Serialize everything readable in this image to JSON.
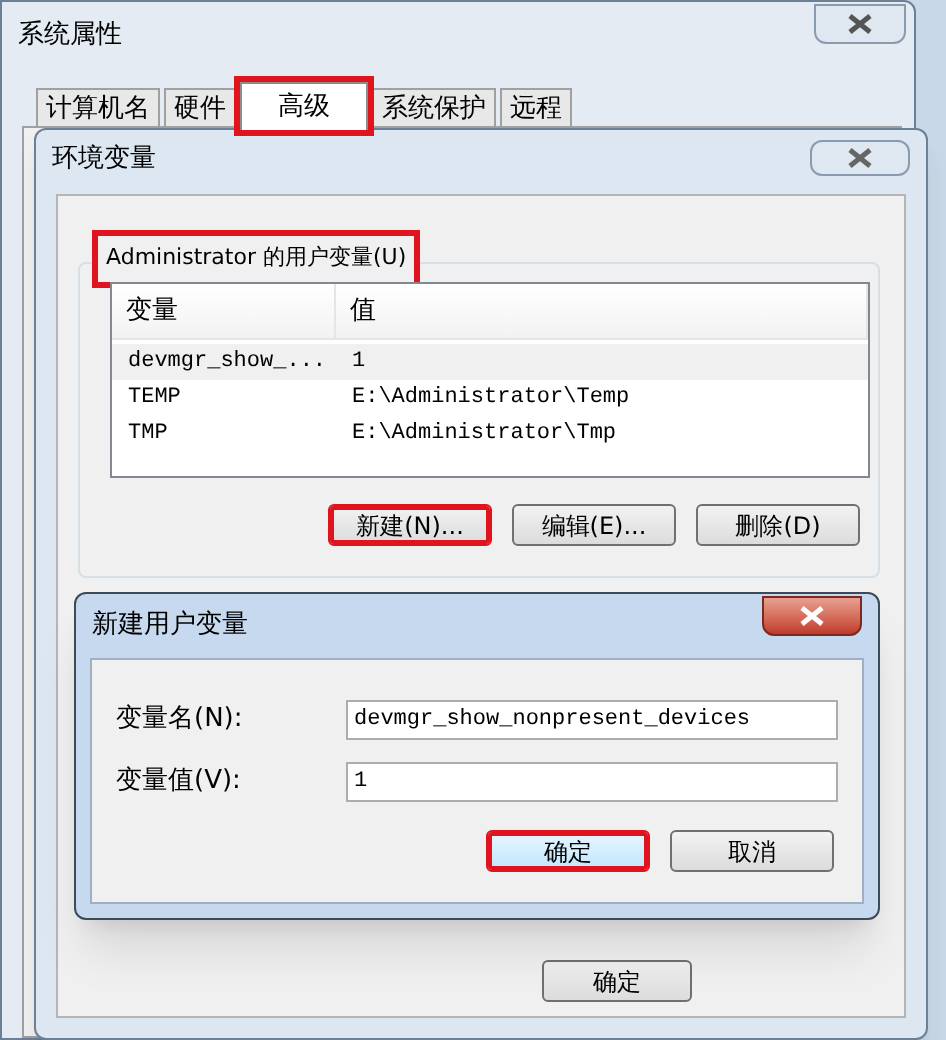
{
  "system_properties": {
    "title": "系统属性",
    "tabs": [
      {
        "label": "计算机名",
        "selected": false,
        "highlighted": false
      },
      {
        "label": "硬件",
        "selected": false,
        "highlighted": false
      },
      {
        "label": "高级",
        "selected": true,
        "highlighted": true
      },
      {
        "label": "系统保护",
        "selected": false,
        "highlighted": false
      },
      {
        "label": "远程",
        "selected": false,
        "highlighted": false
      }
    ]
  },
  "environment_variables": {
    "title": "环境变量",
    "user_group": {
      "label": "Administrator 的用户变量(U)",
      "highlighted": true
    },
    "table": {
      "columns": [
        "变量",
        "值"
      ],
      "rows": [
        {
          "cells": [
            "devmgr_show_...",
            "1"
          ],
          "selected": true
        },
        {
          "cells": [
            "TEMP",
            "E:\\Administrator\\Temp"
          ],
          "selected": false
        },
        {
          "cells": [
            "TMP",
            "E:\\Administrator\\Tmp"
          ],
          "selected": false
        }
      ]
    },
    "buttons": [
      {
        "label": "新建(N)...",
        "highlighted": true
      },
      {
        "label": "编辑(E)...",
        "highlighted": false
      },
      {
        "label": "删除(D)",
        "highlighted": false
      }
    ],
    "bottom_buttons": [
      {
        "label": "确定",
        "highlighted": false
      }
    ]
  },
  "new_user_variable": {
    "title": "新建用户变量",
    "fields": [
      {
        "label": "变量名(N):",
        "value": "devmgr_show_nonpresent_devices"
      },
      {
        "label": "变量值(V):",
        "value": "1"
      }
    ],
    "buttons": [
      {
        "label": "确定",
        "default": true,
        "highlighted": true
      },
      {
        "label": "取消",
        "default": false,
        "highlighted": false
      }
    ]
  }
}
